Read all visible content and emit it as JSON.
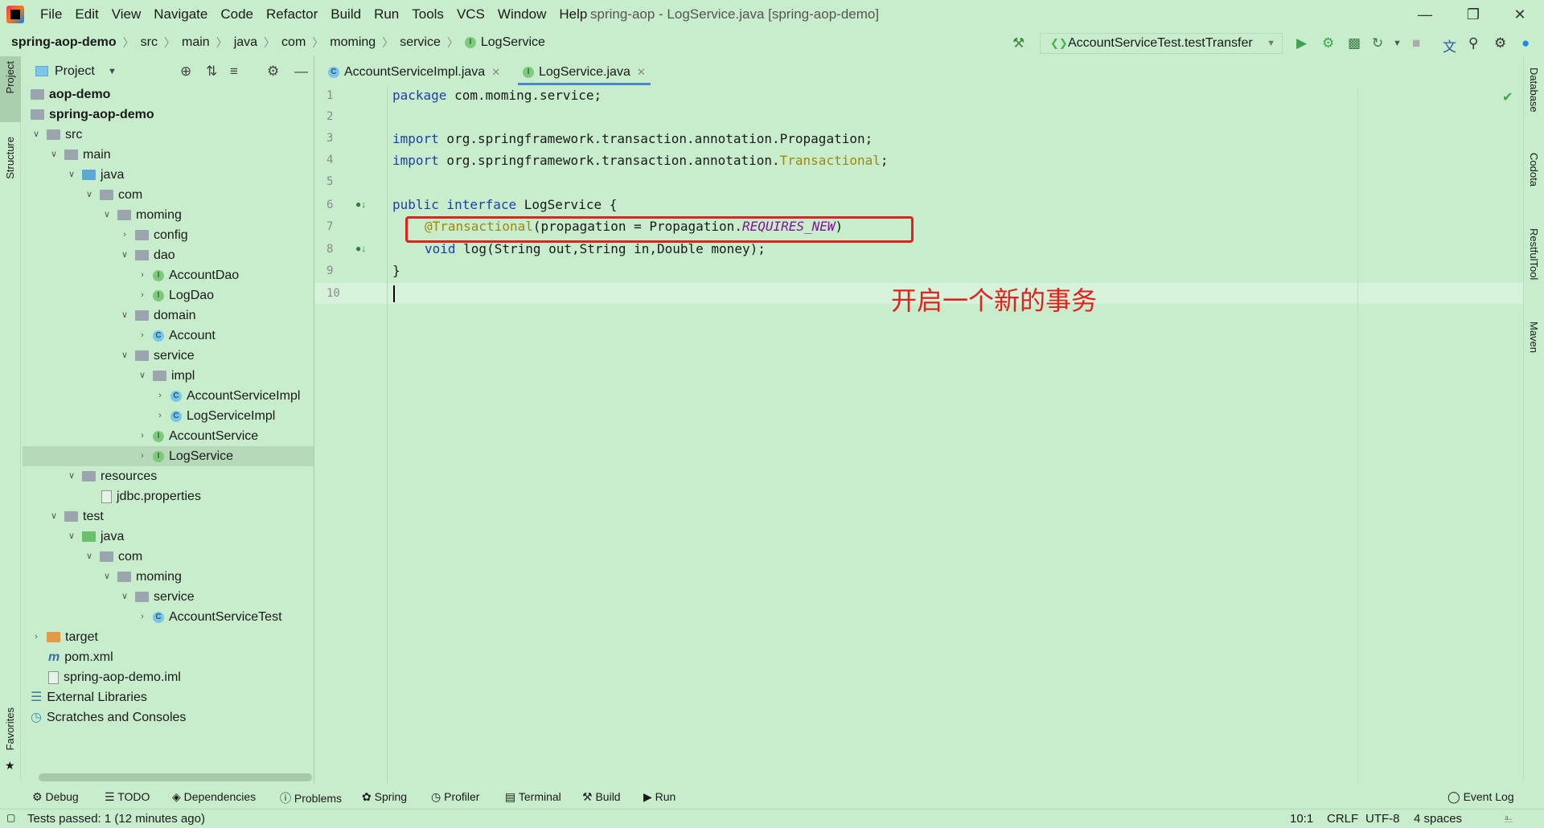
{
  "titlebar": {
    "menu": [
      "File",
      "Edit",
      "View",
      "Navigate",
      "Code",
      "Refactor",
      "Build",
      "Run",
      "Tools",
      "VCS",
      "Window",
      "Help"
    ],
    "title": "spring-aop - LogService.java [spring-aop-demo]"
  },
  "breadcrumb": [
    "spring-aop-demo",
    "src",
    "main",
    "java",
    "com",
    "moming",
    "service",
    "LogService"
  ],
  "run_config": "AccountServiceTest.testTransfer",
  "side_tools": {
    "left": [
      "Project",
      "Structure",
      "Favorites"
    ],
    "right": [
      "Database",
      "Codota",
      "RestfulTool",
      "Maven"
    ]
  },
  "project_panel": {
    "title": "Project"
  },
  "tree": [
    {
      "label": "aop-demo",
      "bold": true
    },
    {
      "label": "spring-aop-demo",
      "bold": true
    },
    {
      "label": "src"
    },
    {
      "label": "main"
    },
    {
      "label": "java"
    },
    {
      "label": "com"
    },
    {
      "label": "moming"
    },
    {
      "label": "config"
    },
    {
      "label": "dao"
    },
    {
      "label": "AccountDao"
    },
    {
      "label": "LogDao"
    },
    {
      "label": "domain"
    },
    {
      "label": "Account"
    },
    {
      "label": "service"
    },
    {
      "label": "impl"
    },
    {
      "label": "AccountServiceImpl"
    },
    {
      "label": "LogServiceImpl"
    },
    {
      "label": "AccountService"
    },
    {
      "label": "LogService",
      "selected": true
    },
    {
      "label": "resources"
    },
    {
      "label": "jdbc.properties"
    },
    {
      "label": "test"
    },
    {
      "label": "java"
    },
    {
      "label": "com"
    },
    {
      "label": "moming"
    },
    {
      "label": "service"
    },
    {
      "label": "AccountServiceTest"
    },
    {
      "label": "target"
    },
    {
      "label": "pom.xml"
    },
    {
      "label": "spring-aop-demo.iml"
    },
    {
      "label": "External Libraries"
    },
    {
      "label": "Scratches and Consoles"
    }
  ],
  "tabs": [
    {
      "label": "AccountServiceImpl.java",
      "active": false
    },
    {
      "label": "LogService.java",
      "active": true
    }
  ],
  "editor": {
    "line_numbers": [
      "1",
      "2",
      "3",
      "4",
      "5",
      "6",
      "7",
      "8",
      "9",
      "10"
    ],
    "lines": {
      "l1_kw": "package",
      "l1_rest": " com.moming.service;",
      "l3_kw": "import",
      "l3_rest": " org.springframework.transaction.annotation.Propagation;",
      "l4_kw": "import",
      "l4_rest": " org.springframework.transaction.annotation.",
      "l4_ann": "Transactional",
      "l4_end": ";",
      "l6_kw1": "public",
      "l6_kw2": " interface",
      "l6_rest": " LogService {",
      "l7_ann": "@Transactional",
      "l7_rest": "(propagation = Propagation.",
      "l7_const": "REQUIRES_NEW",
      "l7_end": ")",
      "l8_kw": "void",
      "l8_rest": " log(String out,String in,Double money);",
      "l9": "}"
    },
    "annotation_note": "开启一个新的事务",
    "highlight_color": "#e3201b"
  },
  "bottom_tools": [
    "Debug",
    "TODO",
    "Dependencies",
    "Problems",
    "Spring",
    "Profiler",
    "Terminal",
    "Build",
    "Run",
    "Event Log"
  ],
  "status": {
    "message": "Tests passed: 1 (12 minutes ago)",
    "position": "10:1",
    "line_sep": "CRLF",
    "encoding": "UTF-8",
    "indent": "4 spaces"
  }
}
